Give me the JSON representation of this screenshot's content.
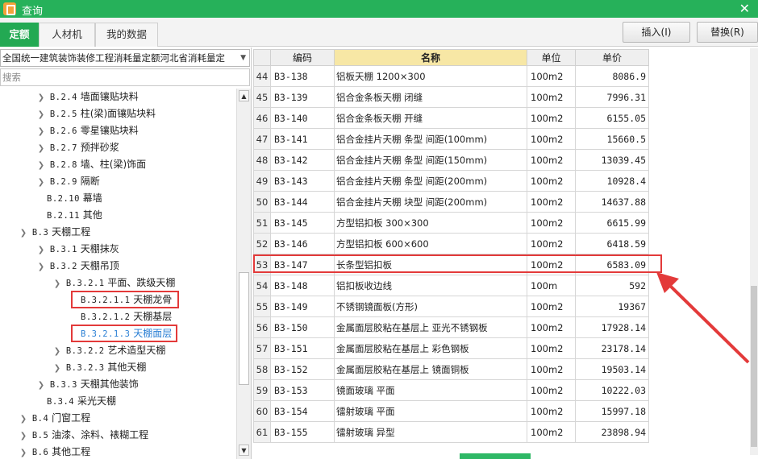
{
  "window": {
    "title": "查询",
    "close_glyph": "✕"
  },
  "tabs": [
    {
      "label": "定额",
      "active": true
    },
    {
      "label": "人材机",
      "active": false
    },
    {
      "label": "我的数据",
      "active": false
    }
  ],
  "buttons": {
    "insert": "插入(I)",
    "replace": "替换(R)"
  },
  "library_select": {
    "value": "全国统一建筑装饰装修工程消耗量定额河北省消耗量定"
  },
  "search": {
    "placeholder": "搜索"
  },
  "tree": [
    {
      "code": "B.2.4",
      "label": "墙面镶贴块料"
    },
    {
      "code": "B.2.5",
      "label": "柱(梁)面镶贴块料"
    },
    {
      "code": "B.2.6",
      "label": "零星镶贴块料"
    },
    {
      "code": "B.2.7",
      "label": "预拌砂浆"
    },
    {
      "code": "B.2.8",
      "label": "墙、柱(梁)饰面"
    },
    {
      "code": "B.2.9",
      "label": "隔断"
    },
    {
      "code": "B.2.10",
      "label": "幕墙"
    },
    {
      "code": "B.2.11",
      "label": "其他"
    },
    {
      "code": "B.3",
      "label": "天棚工程"
    },
    {
      "code": "B.3.1",
      "label": "天棚抹灰"
    },
    {
      "code": "B.3.2",
      "label": "天棚吊顶"
    },
    {
      "code": "B.3.2.1",
      "label": "平面、跌级天棚"
    },
    {
      "code": "B.3.2.1.1",
      "label": "天棚龙骨"
    },
    {
      "code": "B.3.2.1.2",
      "label": "天棚基层"
    },
    {
      "code": "B.3.2.1.3",
      "label": "天棚面层"
    },
    {
      "code": "B.3.2.2",
      "label": "艺术造型天棚"
    },
    {
      "code": "B.3.2.3",
      "label": "其他天棚"
    },
    {
      "code": "B.3.3",
      "label": "天棚其他装饰"
    },
    {
      "code": "B.3.4",
      "label": "采光天棚"
    },
    {
      "code": "B.4",
      "label": "门窗工程"
    },
    {
      "code": "B.5",
      "label": "油漆、涂料、裱糊工程"
    },
    {
      "code": "B.6",
      "label": "其他工程"
    }
  ],
  "table": {
    "headers": {
      "code": "编码",
      "name": "名称",
      "unit": "单位",
      "price": "单价"
    },
    "rows": [
      {
        "idx": "44",
        "code": "B3-138",
        "name": "铝板天棚 1200×300",
        "unit": "100m2",
        "price": "8086.9"
      },
      {
        "idx": "45",
        "code": "B3-139",
        "name": "铝合金条板天棚 闭缝",
        "unit": "100m2",
        "price": "7996.31"
      },
      {
        "idx": "46",
        "code": "B3-140",
        "name": "铝合金条板天棚 开缝",
        "unit": "100m2",
        "price": "6155.05"
      },
      {
        "idx": "47",
        "code": "B3-141",
        "name": "铝合金挂片天棚 条型 间距(100mm)",
        "unit": "100m2",
        "price": "15660.5"
      },
      {
        "idx": "48",
        "code": "B3-142",
        "name": "铝合金挂片天棚 条型 间距(150mm)",
        "unit": "100m2",
        "price": "13039.45"
      },
      {
        "idx": "49",
        "code": "B3-143",
        "name": "铝合金挂片天棚 条型 间距(200mm)",
        "unit": "100m2",
        "price": "10928.4"
      },
      {
        "idx": "50",
        "code": "B3-144",
        "name": "铝合金挂片天棚 块型 间距(200mm)",
        "unit": "100m2",
        "price": "14637.88"
      },
      {
        "idx": "51",
        "code": "B3-145",
        "name": "方型铝扣板 300×300",
        "unit": "100m2",
        "price": "6615.99"
      },
      {
        "idx": "52",
        "code": "B3-146",
        "name": "方型铝扣板 600×600",
        "unit": "100m2",
        "price": "6418.59"
      },
      {
        "idx": "53",
        "code": "B3-147",
        "name": "长条型铝扣板",
        "unit": "100m2",
        "price": "6583.09"
      },
      {
        "idx": "54",
        "code": "B3-148",
        "name": "铝扣板收边线",
        "unit": "100m",
        "price": "592"
      },
      {
        "idx": "55",
        "code": "B3-149",
        "name": "不锈钢镜面板(方形)",
        "unit": "100m2",
        "price": "19367"
      },
      {
        "idx": "56",
        "code": "B3-150",
        "name": "金属面层胶粘在基层上 亚光不锈钢板",
        "unit": "100m2",
        "price": "17928.14"
      },
      {
        "idx": "57",
        "code": "B3-151",
        "name": "金属面层胶粘在基层上 彩色钢板",
        "unit": "100m2",
        "price": "23178.14"
      },
      {
        "idx": "58",
        "code": "B3-152",
        "name": "金属面层胶粘在基层上 镜面铜板",
        "unit": "100m2",
        "price": "19503.14"
      },
      {
        "idx": "59",
        "code": "B3-153",
        "name": "镜面玻璃 平面",
        "unit": "100m2",
        "price": "10222.03"
      },
      {
        "idx": "60",
        "code": "B3-154",
        "name": "镭射玻璃 平面",
        "unit": "100m2",
        "price": "15997.18"
      },
      {
        "idx": "61",
        "code": "B3-155",
        "name": "镭射玻璃 异型",
        "unit": "100m2",
        "price": "23898.94"
      }
    ]
  },
  "colors": {
    "accent": "#26b15a",
    "highlight": "#e33a3a",
    "header_name_bg": "#f7e7a5",
    "selected_text": "#2a7fd4"
  }
}
